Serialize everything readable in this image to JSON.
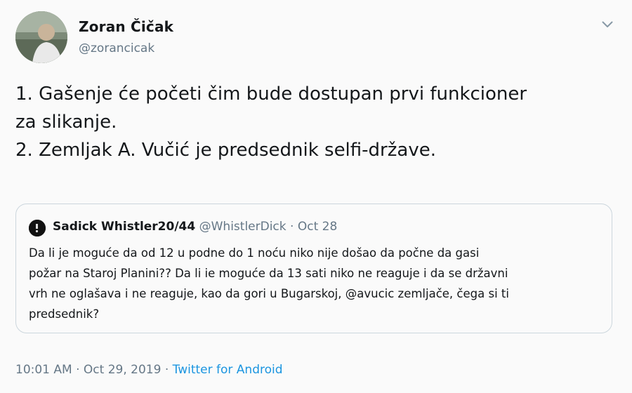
{
  "tweet": {
    "author_name": "Zoran Čičak",
    "author_handle": "@zorancicak",
    "text_lines": [
      "1. Gašenje će početi čim bude dostupan prvi funkcioner",
      "za slikanje.",
      "2. Zemljak A. Vučić je predsednik selfi-države."
    ],
    "time": "10:01 AM",
    "separator": "·",
    "date": "Oct 29, 2019",
    "source": "Twitter for Android"
  },
  "quoted_tweet": {
    "author_name": "Sadick Whistler20/44",
    "author_handle": "@WhistlerDick",
    "separator": "·",
    "date": "Oct 28",
    "text_lines": [
      "Da li je moguće da od 12 u podne do 1 noću niko nije došao da počne da gasi",
      "požar na Staroj Planini?? Da li ie moguće da 13 sati niko ne reaguje i da se državni",
      "vrh ne oglašava i ne reaguje, kao da gori u Bugarskoj, @avucic zemljače, čega si ti",
      "predsednik?"
    ]
  },
  "icons": {
    "menu": "chevron-down-icon",
    "author_avatar": "avatar",
    "quoted_avatar": "avatar"
  },
  "colors": {
    "text": "#14171a",
    "secondary": "#657786",
    "link": "#1b95e0",
    "border": "#ccd6dd",
    "background": "#fafafa"
  }
}
